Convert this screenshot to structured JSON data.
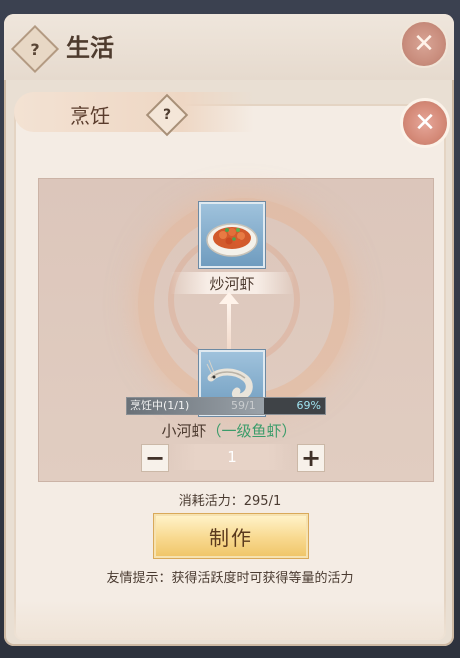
{
  "outer": {
    "title": "生活",
    "help": "?",
    "close": "✕"
  },
  "panel": {
    "title": "烹饪",
    "help": "?",
    "close": "✕"
  },
  "product": {
    "name": "炒河虾"
  },
  "progress": {
    "status": "烹饪中(1/1)",
    "count": "59/1",
    "percent": "69%",
    "fraction": 0.69
  },
  "ingredient": {
    "name": "小河虾",
    "tier": "（一级鱼虾）"
  },
  "stepper": {
    "minus": "−",
    "value": "1",
    "plus": "+"
  },
  "cost": {
    "text": "消耗活力：295/1"
  },
  "action": {
    "label": "制作"
  },
  "tip": {
    "text": "友情提示：获得活跃度时可获得等量的活力"
  },
  "icons": {
    "product": "stir-fried-shrimp-icon",
    "ingredient": "river-shrimp-icon"
  }
}
